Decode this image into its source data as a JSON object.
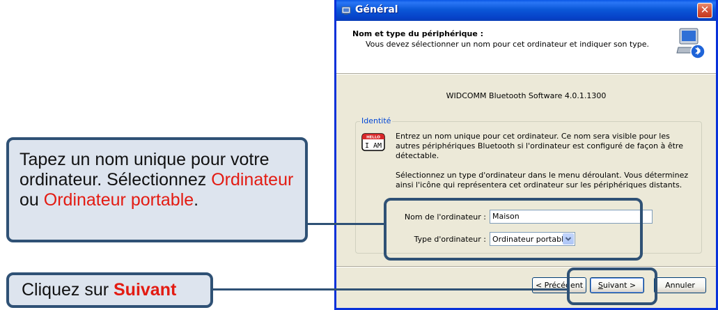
{
  "callouts": {
    "fields": {
      "text_1": "Tapez un nom unique pour votre ordinateur. Sélectionnez ",
      "option_1": "Ordinateur",
      "text_2": " ou ",
      "option_2": "Ordinateur portable",
      "text_3": "."
    },
    "next": {
      "text_1": "Cliquez sur ",
      "action": "Suivant"
    }
  },
  "dialog": {
    "title": "Général",
    "close_label": "✕",
    "header": {
      "title": "Nom et type du périphérique :",
      "subtitle": "Vous devez sélectionner un nom pour cet ordinateur et indiquer son type."
    },
    "software_version": "WIDCOMM Bluetooth Software 4.0.1.1300",
    "identity": {
      "legend": "Identité",
      "icon_text": "I AM",
      "icon_badge": "HELLO",
      "description": "Entrez un nom unique pour cet ordinateur. Ce nom sera visible pour les autres périphériques Bluetooth si l'ordinateur est configuré de façon à être détectable.",
      "type_description": "Sélectionnez un type d'ordinateur dans le menu déroulant. Vous déterminez ainsi l'icône qui représentera cet ordinateur sur les périphériques distants.",
      "name_label": "Nom de l'ordinateur :",
      "name_value": "Maison",
      "type_label": "Type d'ordinateur :",
      "type_value": "Ordinateur portable"
    },
    "buttons": {
      "previous": "< Précédent",
      "next_underlined": "S",
      "next_rest": "uivant >",
      "cancel": "Annuler"
    }
  },
  "colors": {
    "callout_border": "#2f5175",
    "callout_fill": "#dde4ee",
    "highlight_red": "#e31b12",
    "xp_blue": "#0831d9"
  }
}
